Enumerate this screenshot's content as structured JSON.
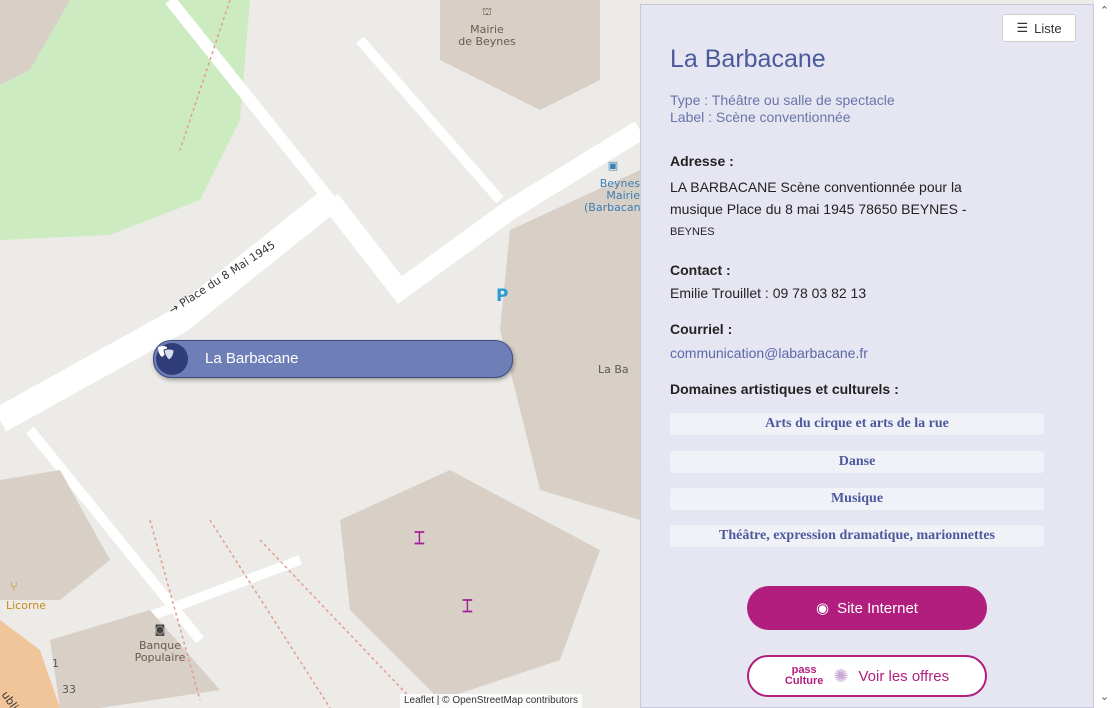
{
  "map": {
    "labels": {
      "mairie": "Mairie\nde Beynes",
      "bus_stop": "Beynes\nMairie\n(Barbacane",
      "street": "→ Place du 8 Mai 1945",
      "parking": "P",
      "la_ba": "La Ba",
      "licorne": "Licorne",
      "banque": "Banque\nPopulaire",
      "house_1": "1",
      "house_33": "33",
      "street_bottom": "ublique"
    },
    "attribution": "Leaflet | © OpenStreetMap contributors",
    "marker": {
      "label": "La Barbacane",
      "icon": "theater-masks-icon"
    },
    "colors": {
      "ground": "#ecebe8",
      "park": "#cdebc0",
      "building": "#d8cfc7",
      "road": "#ffffff",
      "marker": "#6e7fb8"
    }
  },
  "panel": {
    "liste_button": "Liste",
    "title": "La Barbacane",
    "type": "Type : Théâtre ou salle de spectacle",
    "label": "Label : Scène conventionnée",
    "address_label": "Adresse :",
    "address_line1": "LA BARBACANE Scène conventionnée pour la",
    "address_line2": "musique Place du 8 mai 1945 78650 BEYNES -",
    "address_line3": "BEYNES",
    "contact_label": "Contact :",
    "contact_value": "Emilie Trouillet : 09 78 03 82 13",
    "email_label": "Courriel :",
    "email_value": "communication@labarbacane.fr",
    "domains_label": "Domaines artistiques et culturels :",
    "domains": [
      "Arts du cirque et arts de la rue",
      "Danse",
      "Musique",
      "Théâtre, expression dramatique, marionnettes"
    ],
    "site_button": "Site Internet",
    "pass_logo_line1": "pass",
    "pass_logo_line2": "Culture",
    "pass_button": "Voir les offres",
    "colors": {
      "background": "#e6e6f2",
      "title": "#4b5a9c",
      "accent": "#b21e7e"
    }
  }
}
